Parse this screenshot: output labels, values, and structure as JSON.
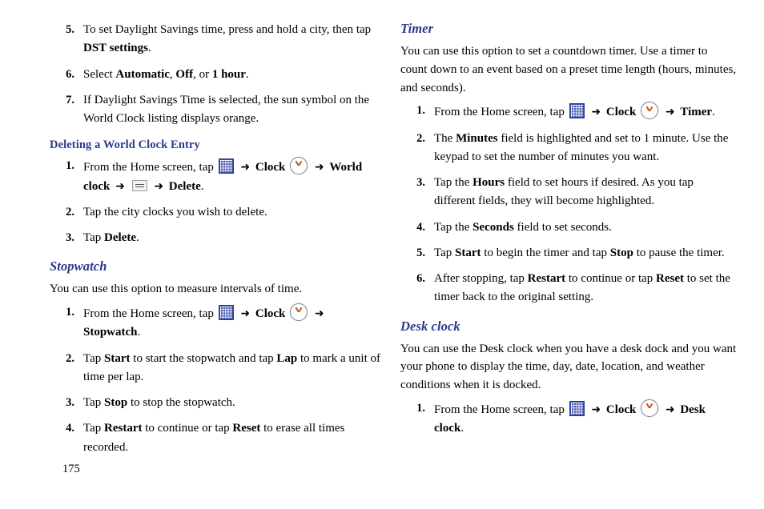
{
  "page": {
    "number": "175"
  },
  "left_column": {
    "continued_list": [
      {
        "num": "5.",
        "html": "To set Daylight Savings time, press and hold a city, then tap <b>DST settings</b>."
      },
      {
        "num": "6.",
        "html": "Select <b>Automatic</b>, <b>Off</b>, or <b>1 hour</b>."
      },
      {
        "num": "7.",
        "html": "If Daylight Savings Time is selected, the sun symbol on the World Clock listing displays orange."
      }
    ],
    "deleting_heading": "Deleting a World Clock Entry",
    "deleting_list": [
      {
        "num": "1.",
        "html": "From the Home screen, tap <span class=\"ico ico-apps\"></span> <span class=\"arrow\">➜</span> <b>Clock</b> <span class=\"ico ico-clock\"></span> <span class=\"arrow\">➜</span> <b>World clock</b> <span class=\"arrow\">➜</span> <span class=\"ico ico-menu\"></span> <span class=\"arrow\">➜</span> <b>Delete</b>."
      },
      {
        "num": "2.",
        "html": "Tap the city clocks you wish to delete."
      },
      {
        "num": "3.",
        "html": "Tap <b>Delete</b>."
      }
    ],
    "stopwatch_heading": "Stopwatch",
    "stopwatch_intro": "You can use this option to measure intervals of time.",
    "stopwatch_list": [
      {
        "num": "1.",
        "html": "From the Home screen, tap <span class=\"ico ico-apps\"></span> <span class=\"arrow\">➜</span> <b>Clock</b> <span class=\"ico ico-clock\"></span> <span class=\"arrow\">➜</span> <b>Stopwatch</b>."
      },
      {
        "num": "2.",
        "html": "Tap <b>Start</b> to start the stopwatch and tap <b>Lap</b> to mark a unit of time per lap."
      },
      {
        "num": "3.",
        "html": "Tap <b>Stop</b> to stop the stopwatch."
      },
      {
        "num": "4.",
        "html": "Tap <b>Restart</b> to continue or tap <b>Reset</b> to erase all times recorded."
      }
    ]
  },
  "right_column": {
    "timer_heading": "Timer",
    "timer_intro": "You can use this option to set a countdown timer. Use a timer to count down to an event based on a preset time length (hours, minutes, and seconds).",
    "timer_list": [
      {
        "num": "1.",
        "html": "From the Home screen, tap <span class=\"ico ico-apps\"></span> <span class=\"arrow\">➜</span> <b>Clock</b> <span class=\"ico ico-clock\"></span> <span class=\"arrow\">➜</span> <b>Timer</b>."
      },
      {
        "num": "2.",
        "html": "The <b>Minutes</b> field is highlighted and set to 1 minute. Use the keypad to set the number of minutes you want."
      },
      {
        "num": "3.",
        "html": "Tap the <b>Hours</b> field to set hours if desired. As you tap different fields, they will become highlighted."
      },
      {
        "num": "4.",
        "html": "Tap the <b>Seconds</b> field to set seconds."
      },
      {
        "num": "5.",
        "html": "Tap <b>Start</b> to begin the timer and tap <b>Stop</b> to pause the timer."
      },
      {
        "num": "6.",
        "html": "After stopping, tap <b>Restart</b> to continue or tap <b>Reset</b> to set the timer back to the original setting."
      }
    ],
    "desk_heading": "Desk clock",
    "desk_intro": "You can use the Desk clock when you have a desk dock and you want your phone to display the time, day, date, location, and weather conditions when it is docked.",
    "desk_list": [
      {
        "num": "1.",
        "html": "From the Home screen, tap <span class=\"ico ico-apps\"></span> <span class=\"arrow\">➜</span> <b>Clock</b> <span class=\"ico ico-clock\"></span> <span class=\"arrow\">➜</span> <b>Desk clock</b>."
      }
    ]
  }
}
